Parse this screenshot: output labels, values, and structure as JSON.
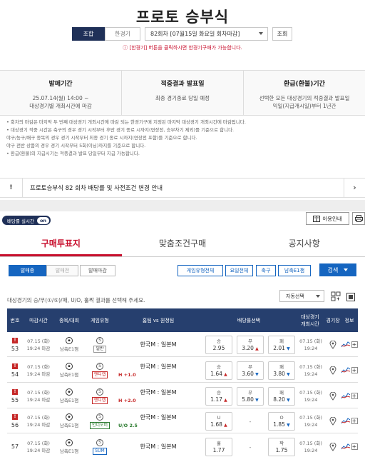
{
  "header": {
    "title": "프로토 승부식"
  },
  "controls": {
    "tab_on": "조합",
    "tab_off": "한경기",
    "round_select": "82회차 [07월15일 화요일 회차마감]",
    "query_button": "조회"
  },
  "notice": "[한경기] 버튼을 클릭하시면 한경기구매가 가능합니다.",
  "info": [
    {
      "heading": "발매기간",
      "lines": [
        "25.07.14(월) 14:00 ~",
        "대상경기별 개최시간에 마감"
      ]
    },
    {
      "heading": "적중결과 발표일",
      "lines": [
        "최종 경기종료 당일 예정"
      ]
    },
    {
      "heading": "환급(환불)기간",
      "lines": [
        "선택한 모든 대상경기의 적중결과 발표일",
        "익일(지급개시일)부터 1년간"
      ]
    }
  ],
  "notes": [
    "• 회차의 마감은 마지막 두 번째 대상경기 개최시간에 마감 되는 한경기구매 지정된 마지막 대상경기 개최시간에 마감됩니다.",
    "• 대상경기 적중 시간은 축구의 경우 경기 시작부터 후반 경기 종료 시까지(연장전, 승부차기 제외)를 기준으로 합니다.",
    "  야구/농구/배구 종목의 경우 경기 시작부터 최종 경기 종료 시까지(연장전 포함)를 기준으로 합니다.",
    "  야구 전반 상품의 경우 경기 시작부터 5회(이닝)까지를 기준으로 합니다.",
    "• 환급(환불)의 지급시기는 적중결과 발표 당일부터 지급 가능합니다."
  ],
  "banner": {
    "mark": "!",
    "text": "프로토승부식 82 회차 배당률 및 사전조건 변경 안내",
    "chevron": "›"
  },
  "live": {
    "label": "배당률 실시간",
    "toggle": "on"
  },
  "guide_button": "이용안내",
  "tabs": [
    "구매투표지",
    "맞춤조건구매",
    "공지사항"
  ],
  "filters": {
    "status": [
      "발매중",
      "발매전",
      "발매마감"
    ],
    "categories": [
      "게임유형전체",
      "요일전체",
      "축구",
      "남축E1챔"
    ],
    "search": "검색"
  },
  "hint": "대상경기의 승/무(①/⑤)/패, U/O, 홀짝 결과를 선택해 주세요.",
  "auto_select": "자동선택",
  "table": {
    "headers": {
      "no": "번호",
      "deadline": "마감시간",
      "league": "종목/대회",
      "gametype": "게임유형",
      "match": "홈팀 vs 원정팀",
      "odds": "배당률선택",
      "start": "대상경기\n개최시간",
      "venue": "경기장",
      "info": "정보"
    },
    "rows": [
      {
        "flag": "!",
        "no": "53",
        "date": "07.15 (화)",
        "time": "19:24 마감",
        "league": "남축E1챔",
        "type_icon": "S",
        "type": "일반",
        "type_color": "plain",
        "match": "한국M : 일본M",
        "handicap": "",
        "odds": [
          {
            "label": "승",
            "value": "2.95",
            "arrow": ""
          },
          {
            "label": "무",
            "value": "3.20",
            "arrow": "▲"
          },
          {
            "label": "패",
            "value": "2.01",
            "arrow": "▼"
          }
        ],
        "start_date": "07.15 (화)",
        "start_time": "19:24"
      },
      {
        "flag": "!",
        "no": "54",
        "date": "07.15 (화)",
        "time": "19:24 마감",
        "league": "남축E1챔",
        "type_icon": "S",
        "type": "핸디캡",
        "type_color": "red",
        "match": "한국M : 일본M",
        "handicap": "H +1.0",
        "odds": [
          {
            "label": "승",
            "value": "1.64",
            "arrow": "▲"
          },
          {
            "label": "무",
            "value": "3.60",
            "arrow": "▼"
          },
          {
            "label": "패",
            "value": "3.80",
            "arrow": "▼"
          }
        ],
        "start_date": "07.15 (화)",
        "start_time": "19:24"
      },
      {
        "flag": "!",
        "no": "55",
        "date": "07.15 (화)",
        "time": "19:24 마감",
        "league": "남축E1챔",
        "type_icon": "S",
        "type": "핸디캡",
        "type_color": "red",
        "match": "한국M : 일본M",
        "handicap": "H +2.0",
        "odds": [
          {
            "label": "승",
            "value": "1.17",
            "arrow": "▲"
          },
          {
            "label": "무",
            "value": "5.80",
            "arrow": "▼"
          },
          {
            "label": "패",
            "value": "8.20",
            "arrow": "▼"
          }
        ],
        "start_date": "07.15 (화)",
        "start_time": "19:24"
      },
      {
        "flag": "!",
        "no": "56",
        "date": "07.15 (화)",
        "time": "19:24 마감",
        "league": "남축E1챔",
        "type_icon": "S",
        "type": "언더오버",
        "type_color": "green",
        "match": "한국M : 일본M",
        "handicap": "U/O 2.5",
        "odds": [
          {
            "label": "U",
            "value": "1.68",
            "arrow": "▲"
          },
          {
            "label": "",
            "value": "-",
            "arrow": ""
          },
          {
            "label": "O",
            "value": "1.85",
            "arrow": "▼"
          }
        ],
        "start_date": "07.15 (화)",
        "start_time": "19:24"
      },
      {
        "flag": "",
        "no": "57",
        "date": "07.15 (화)",
        "time": "19:24 마감",
        "league": "남축E1챔",
        "type_icon": "S",
        "type": "SUM",
        "type_color": "blue",
        "match": "한국M : 일본M",
        "handicap": "",
        "odds": [
          {
            "label": "홀",
            "value": "1.77",
            "arrow": ""
          },
          {
            "label": "",
            "value": "-",
            "arrow": ""
          },
          {
            "label": "짝",
            "value": "1.75",
            "arrow": ""
          }
        ],
        "start_date": "07.15 (화)",
        "start_time": "19:24"
      }
    ]
  },
  "colors": {
    "navy": "#1f3058",
    "header_navy": "#263f6e",
    "blue": "#1565c0",
    "red": "#c8102e",
    "green": "#2e7d32"
  }
}
